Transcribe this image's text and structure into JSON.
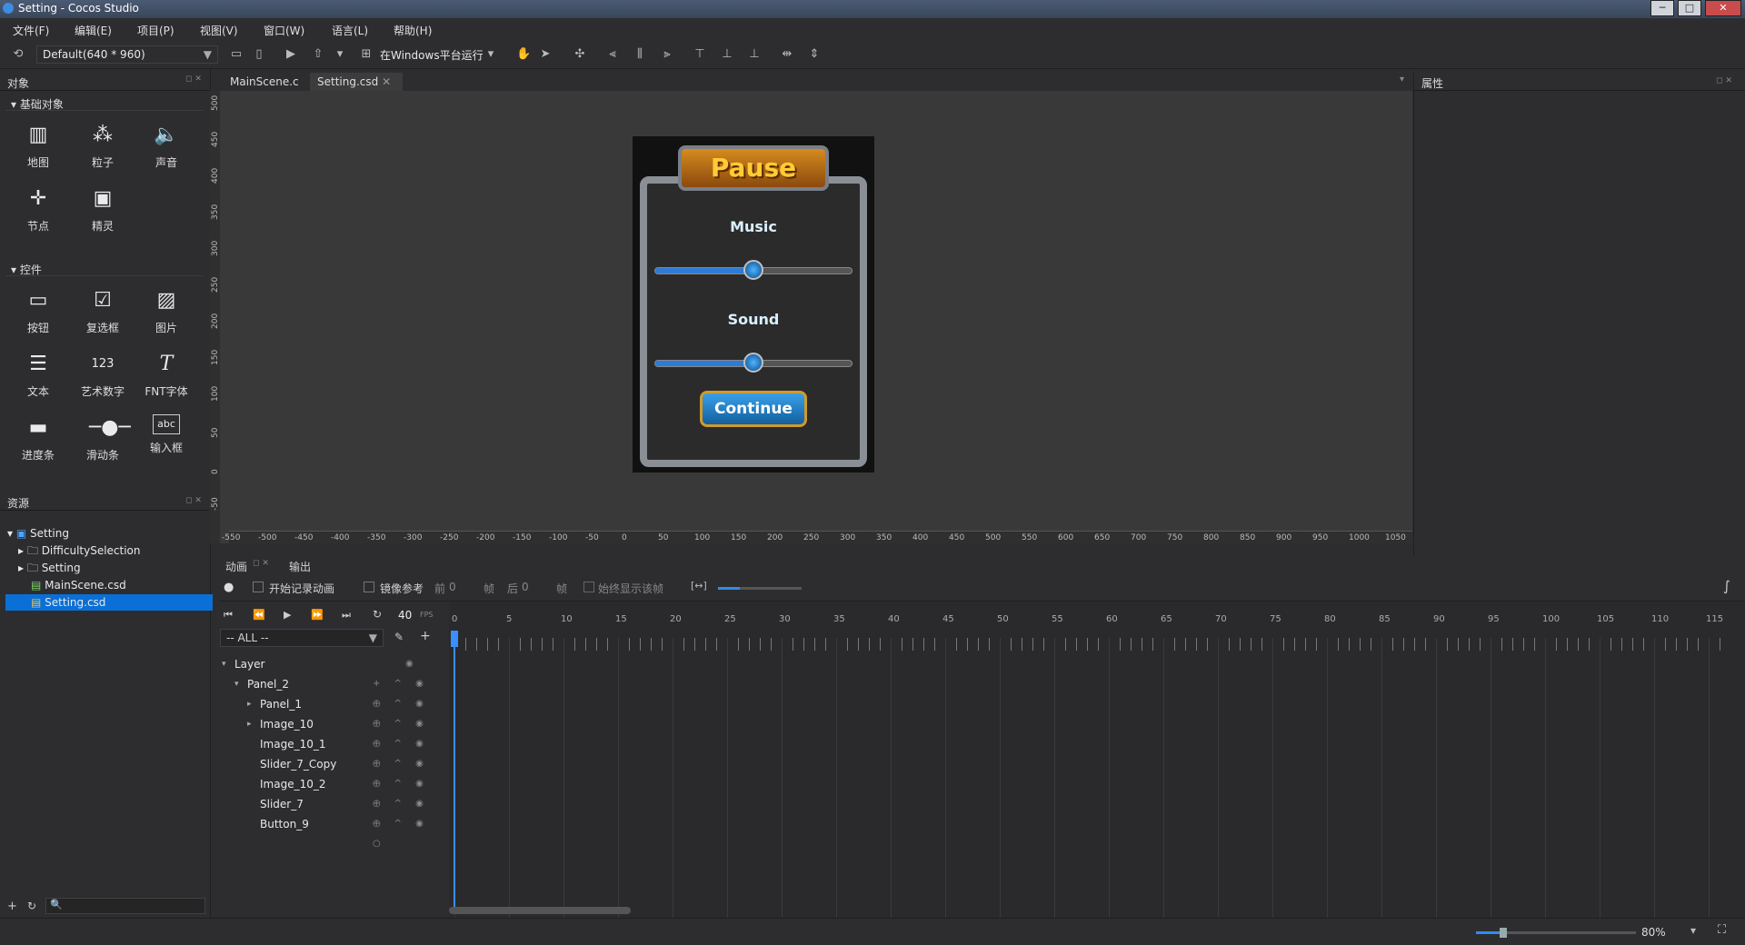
{
  "window": {
    "title": "Setting - Cocos Studio",
    "min": "─",
    "max": "□",
    "close": "✕"
  },
  "menu": [
    "文件(F)",
    "编辑(E)",
    "项目(P)",
    "视图(V)",
    "窗口(W)",
    "语言(L)",
    "帮助(H)"
  ],
  "toolbar": {
    "resolution": "Default(640 * 960)",
    "run_target": "在Windows平台运行"
  },
  "objects_panel": {
    "title": "对象",
    "basic_section": "基础对象",
    "basic_items": [
      {
        "label": "地图",
        "icon": "map-icon"
      },
      {
        "label": "粒子",
        "icon": "particle-icon"
      },
      {
        "label": "声音",
        "icon": "sound-icon"
      },
      {
        "label": "节点",
        "icon": "node-icon"
      },
      {
        "label": "精灵",
        "icon": "sprite-icon"
      }
    ],
    "controls_section": "控件",
    "control_items": [
      {
        "label": "按钮",
        "icon": "button-icon"
      },
      {
        "label": "复选框",
        "icon": "checkbox-icon"
      },
      {
        "label": "图片",
        "icon": "image-icon"
      },
      {
        "label": "文本",
        "icon": "text-icon"
      },
      {
        "label": "艺术数字",
        "icon": "art-number-icon"
      },
      {
        "label": "FNT字体",
        "icon": "fnt-font-icon"
      },
      {
        "label": "进度条",
        "icon": "progressbar-icon"
      },
      {
        "label": "滑动条",
        "icon": "slider-icon"
      },
      {
        "label": "输入框",
        "icon": "textfield-icon"
      }
    ]
  },
  "resources_panel": {
    "title": "资源",
    "items": [
      {
        "label": "Setting",
        "type": "project"
      },
      {
        "label": "DifficultySelection",
        "type": "folder"
      },
      {
        "label": "Setting",
        "type": "folder"
      },
      {
        "label": "MainScene.csd",
        "type": "csd"
      },
      {
        "label": "Setting.csd",
        "type": "csd",
        "selected": true
      }
    ]
  },
  "doc_tabs": [
    "MainScene.c",
    "Setting.csd"
  ],
  "properties_panel": {
    "title": "属性"
  },
  "game_ui": {
    "title": "Pause",
    "music_label": "Music",
    "sound_label": "Sound",
    "continue_label": "Continue",
    "music_level": 0.5,
    "sound_level": 0.5
  },
  "rulers": {
    "vertical": [
      "500",
      "450",
      "400",
      "350",
      "300",
      "250",
      "200",
      "150",
      "100",
      "50",
      "0",
      "-50"
    ],
    "horizontal": [
      "-550",
      "-500",
      "-450",
      "-400",
      "-350",
      "-300",
      "-250",
      "-200",
      "-150",
      "-100",
      "-50",
      "0",
      "50",
      "100",
      "150",
      "200",
      "250",
      "300",
      "350",
      "400",
      "450",
      "500",
      "550",
      "600",
      "650",
      "700",
      "750",
      "800",
      "850",
      "900",
      "950",
      "1000",
      "1050"
    ]
  },
  "animation": {
    "tabs": [
      "动画",
      "输出"
    ],
    "record_label": "开始记录动画",
    "mirror_label": "镜像参考",
    "before_label": "前",
    "before_value": "0",
    "frame_unit": "帧",
    "after_label": "后",
    "after_value": "0",
    "always_show_label": "始终显示该帧",
    "fps_value": "40",
    "fps_unit": "FPS",
    "filter": "-- ALL --",
    "layers": [
      {
        "name": "Layer",
        "depth": 0,
        "arrow": "▾"
      },
      {
        "name": "Panel_2",
        "depth": 1,
        "arrow": "▾"
      },
      {
        "name": "Panel_1",
        "depth": 2,
        "arrow": "▸"
      },
      {
        "name": "Image_10",
        "depth": 2,
        "arrow": "▸"
      },
      {
        "name": "Image_10_1",
        "depth": 2,
        "arrow": ""
      },
      {
        "name": "Slider_7_Copy",
        "depth": 2,
        "arrow": ""
      },
      {
        "name": "Image_10_2",
        "depth": 2,
        "arrow": ""
      },
      {
        "name": "Slider_7",
        "depth": 2,
        "arrow": ""
      },
      {
        "name": "Button_9",
        "depth": 2,
        "arrow": ""
      }
    ],
    "frame_labels": [
      "0",
      "5",
      "10",
      "15",
      "20",
      "25",
      "30",
      "35",
      "40",
      "45",
      "50",
      "55",
      "60",
      "65",
      "70",
      "75",
      "80",
      "85",
      "90",
      "95",
      "100",
      "105",
      "110",
      "115"
    ]
  },
  "status": {
    "zoom": "80%"
  }
}
